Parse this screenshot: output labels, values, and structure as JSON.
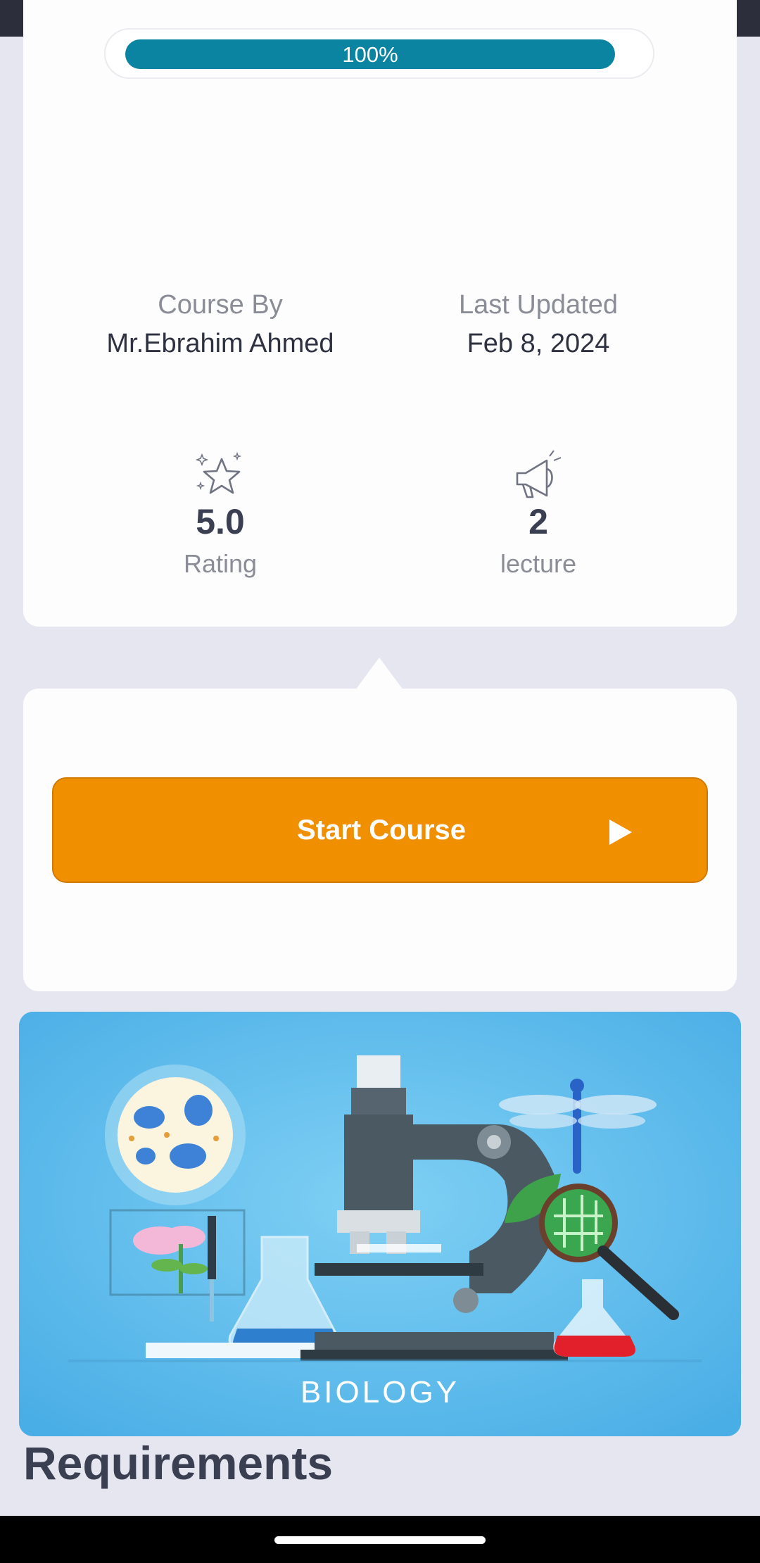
{
  "progress": {
    "label": "100%",
    "value": 1.0
  },
  "course_info": {
    "author_label": "Course By",
    "author_value": "Mr.Ebrahim Ahmed",
    "updated_label": "Last Updated",
    "updated_value": "Feb 8, 2024"
  },
  "stats": {
    "rating": {
      "value": "5.0",
      "label": "Rating",
      "icon": "star-icon"
    },
    "lectures": {
      "value": "2",
      "label": "lecture",
      "icon": "megaphone-icon"
    }
  },
  "start_button": {
    "label": "Start Course",
    "icon": "play-icon"
  },
  "banner": {
    "text": "BIOLOGY"
  },
  "requirements": {
    "title": "Requirements"
  },
  "colors": {
    "accent": "#f09000",
    "progress": "#0a84a0",
    "background": "#e6e6f0"
  }
}
